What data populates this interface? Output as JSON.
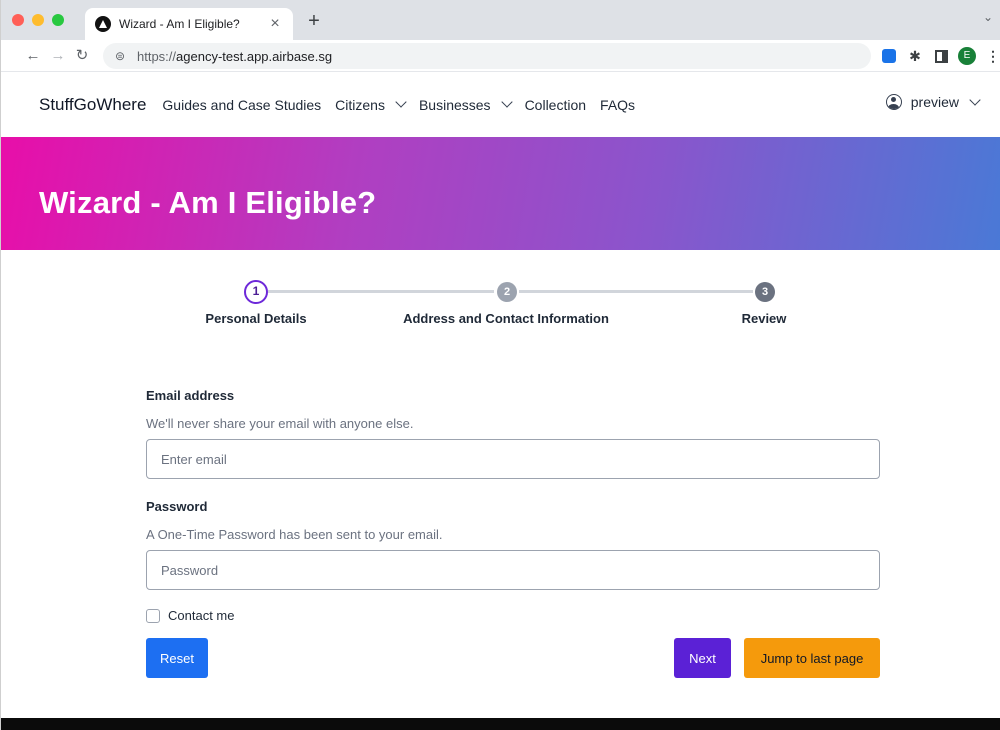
{
  "browser": {
    "tab_title": "Wizard - Am I Eligible?",
    "tab_close": "×",
    "new_tab": "+",
    "url_scheme": "https://",
    "url_host": "agency-test.app.airbase.sg",
    "profile_initial": "E",
    "icons": [
      "back-arrow-icon",
      "forward-arrow-icon",
      "reload-icon",
      "site-info-icon",
      "extension-icon",
      "puzzle-icon",
      "side-panel-icon",
      "more-vert-icon"
    ]
  },
  "navbar": {
    "brand": "StuffGoWhere",
    "links": {
      "guides": "Guides and Case Studies",
      "citizens": "Citizens",
      "businesses": "Businesses",
      "collection": "Collection",
      "faqs": "FAQs"
    },
    "user": "preview"
  },
  "hero": {
    "title": "Wizard - Am I Eligible?"
  },
  "stepper": {
    "steps": [
      {
        "number": "1",
        "label": "Personal Details",
        "state": "active"
      },
      {
        "number": "2",
        "label": "Address and Contact Information",
        "state": "pending"
      },
      {
        "number": "3",
        "label": "Review",
        "state": "pending"
      }
    ]
  },
  "form": {
    "email": {
      "label": "Email address",
      "help": "We'll never share your email with anyone else.",
      "placeholder": "Enter email",
      "value": ""
    },
    "password": {
      "label": "Password",
      "help": "A One-Time Password has been sent to your email.",
      "placeholder": "Password",
      "value": ""
    },
    "contact": {
      "label": "Contact me",
      "checked": false
    }
  },
  "buttons": {
    "reset": "Reset",
    "next": "Next",
    "jump": "Jump to last page"
  },
  "colors": {
    "primary": "#1d6ff2",
    "next": "#5b21d6",
    "jump": "#f59a0c",
    "hero_start": "#e80ea9",
    "hero_end": "#4a79d6"
  }
}
